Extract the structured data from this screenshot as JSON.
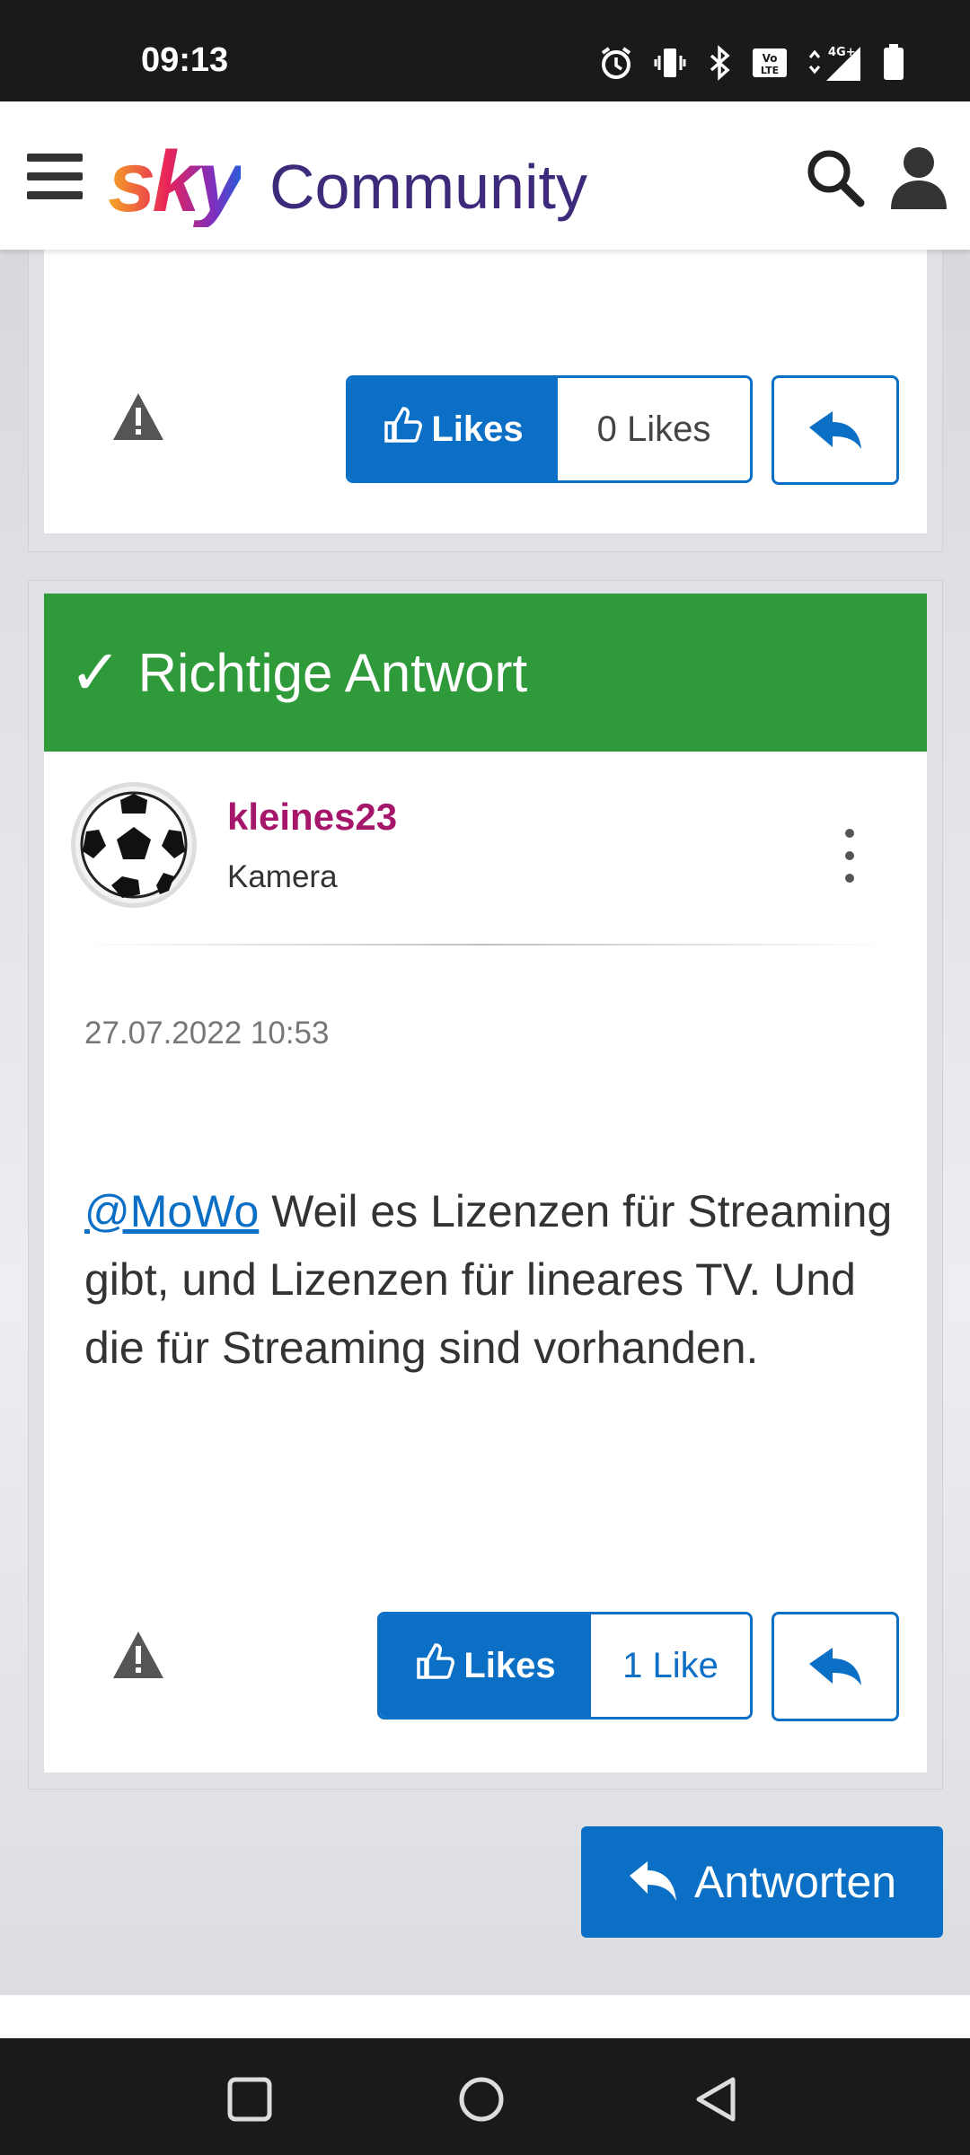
{
  "status_bar": {
    "time": "09:13",
    "icons": [
      "alarm-icon",
      "vibrate-icon",
      "bluetooth-icon",
      "volte-icon",
      "4g-signal-icon",
      "battery-icon"
    ],
    "network": "4G+"
  },
  "header": {
    "logo_text": "sky",
    "title": "Community",
    "icons": [
      "menu-icon",
      "search-icon",
      "profile-icon"
    ]
  },
  "colors": {
    "primary": "#0b6fc6",
    "accepted_green": "#2e9a3a",
    "username": "#a6176b"
  },
  "previous_post": {
    "like_label": "Likes",
    "like_count": "0 Likes"
  },
  "accepted_post": {
    "banner": "Richtige Antwort",
    "author": "kleines23",
    "author_rank": "Kamera",
    "date": "27.07.2022 10:53",
    "mention": "@MoWo",
    "body": " Weil es Lizenzen für Streaming gibt, und Lizenzen für lineares TV. Und die für Streaming sind vorhanden.",
    "like_label": "Likes",
    "like_count": "1 Like"
  },
  "reply_button": {
    "label": "Antworten"
  }
}
